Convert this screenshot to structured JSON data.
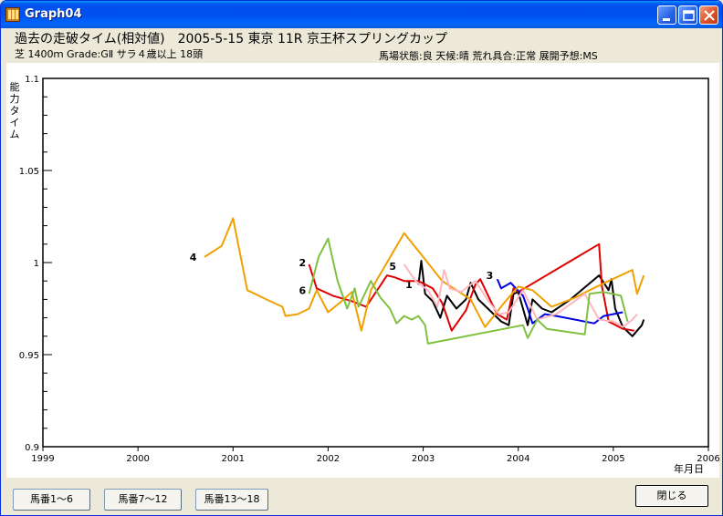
{
  "window": {
    "title": "Graph04"
  },
  "header": {
    "line1": "過去の走破タイム(相対値)　2005-5-15  東京  11R  京王杯スプリングカップ",
    "line2": "芝 1400ｍ  Grade:GⅡ  サラ４歳以上  18頭",
    "conditions": "馬場状態:良    天候:晴    荒れ具合:正常    展開予想:MS"
  },
  "buttons": {
    "horses_1_6": "馬番1～6",
    "horses_7_12": "馬番7～12",
    "horses_13_18": "馬番13～18",
    "close": "閉じる"
  },
  "chart_data": {
    "type": "line",
    "ylabel": "能力タイム",
    "xlabel": "年月日",
    "ylim": [
      0.9,
      1.1
    ],
    "xlim": [
      1999,
      2006
    ],
    "yticks": [
      "1.1",
      "1.05",
      "1",
      "0.95",
      "0.9"
    ],
    "xticks": [
      "1999",
      "2000",
      "2001",
      "2002",
      "2003",
      "2004",
      "2005",
      "2006"
    ],
    "grid": false,
    "series": [
      {
        "name": "1",
        "color": "#000000",
        "label_at": [
          2002.85,
          0.988
        ],
        "points": [
          [
            2002.95,
            0.988
          ],
          [
            2002.98,
            1.001
          ],
          [
            2003.02,
            0.983
          ],
          [
            2003.1,
            0.979
          ],
          [
            2003.18,
            0.97
          ],
          [
            2003.25,
            0.982
          ],
          [
            2003.35,
            0.975
          ],
          [
            2003.45,
            0.98
          ],
          [
            2003.5,
            0.989
          ],
          [
            2003.58,
            0.98
          ],
          [
            2003.72,
            0.973
          ],
          [
            2003.82,
            0.968
          ],
          [
            2003.9,
            0.966
          ],
          [
            2003.95,
            0.983
          ],
          [
            2004.0,
            0.984
          ],
          [
            2004.05,
            0.975
          ],
          [
            2004.1,
            0.966
          ],
          [
            2004.15,
            0.98
          ],
          [
            2004.25,
            0.975
          ],
          [
            2004.35,
            0.973
          ],
          [
            2004.55,
            0.98
          ],
          [
            2004.85,
            0.993
          ],
          [
            2004.95,
            0.985
          ],
          [
            2004.98,
            0.991
          ],
          [
            2005.02,
            0.975
          ],
          [
            2005.1,
            0.965
          ],
          [
            2005.2,
            0.96
          ],
          [
            2005.3,
            0.966
          ],
          [
            2005.32,
            0.969
          ]
        ]
      },
      {
        "name": "2",
        "color": "#E00000",
        "label_at": [
          2001.73,
          1.0
        ],
        "points": [
          [
            2001.8,
            0.999
          ],
          [
            2001.88,
            0.986
          ],
          [
            2002.05,
            0.982
          ],
          [
            2002.25,
            0.979
          ],
          [
            2002.4,
            0.976
          ],
          [
            2002.62,
            0.993
          ],
          [
            2002.7,
            0.992
          ],
          [
            2002.8,
            0.99
          ],
          [
            2002.95,
            0.99
          ],
          [
            2003.1,
            0.986
          ],
          [
            2003.2,
            0.978
          ],
          [
            2003.3,
            0.963
          ],
          [
            2003.45,
            0.974
          ],
          [
            2003.55,
            0.988
          ],
          [
            2003.6,
            0.991
          ],
          [
            2003.72,
            0.978
          ],
          [
            2003.78,
            0.972
          ],
          [
            2003.88,
            0.969
          ],
          [
            2003.95,
            0.986
          ],
          [
            2004.0,
            0.984
          ],
          [
            2004.85,
            1.01
          ],
          [
            2004.88,
            0.987
          ],
          [
            2004.95,
            0.968
          ],
          [
            2005.1,
            0.964
          ],
          [
            2005.22,
            0.963
          ]
        ]
      },
      {
        "name": "3",
        "color": "#0000E0",
        "label_at": [
          2003.7,
          0.993
        ],
        "points": [
          [
            2003.78,
            0.991
          ],
          [
            2003.82,
            0.986
          ],
          [
            2003.92,
            0.989
          ],
          [
            2004.05,
            0.982
          ],
          [
            2004.1,
            0.975
          ],
          [
            2004.15,
            0.967
          ],
          [
            2004.28,
            0.972
          ],
          [
            2004.4,
            0.971
          ],
          [
            2004.8,
            0.967
          ],
          [
            2004.9,
            0.971
          ],
          [
            2005.1,
            0.973
          ]
        ]
      },
      {
        "name": "4",
        "color": "#F0A000",
        "label_at": [
          2000.58,
          1.003
        ],
        "points": [
          [
            2000.7,
            1.003
          ],
          [
            2000.88,
            1.009
          ],
          [
            2001.0,
            1.024
          ],
          [
            2001.15,
            0.985
          ],
          [
            2001.35,
            0.98
          ],
          [
            2001.52,
            0.976
          ],
          [
            2001.55,
            0.971
          ],
          [
            2001.68,
            0.972
          ],
          [
            2001.8,
            0.975
          ],
          [
            2001.88,
            0.985
          ],
          [
            2002.0,
            0.973
          ],
          [
            2002.12,
            0.978
          ],
          [
            2002.25,
            0.984
          ],
          [
            2002.35,
            0.963
          ],
          [
            2002.45,
            0.985
          ],
          [
            2002.8,
            1.016
          ],
          [
            2003.0,
            1.003
          ],
          [
            2003.2,
            0.99
          ],
          [
            2003.5,
            0.98
          ],
          [
            2003.65,
            0.965
          ],
          [
            2003.85,
            0.978
          ],
          [
            2004.0,
            0.987
          ],
          [
            2004.15,
            0.985
          ],
          [
            2004.35,
            0.976
          ],
          [
            2004.6,
            0.981
          ],
          [
            2004.75,
            0.985
          ],
          [
            2004.95,
            0.99
          ],
          [
            2005.2,
            0.996
          ],
          [
            2005.25,
            0.983
          ],
          [
            2005.32,
            0.993
          ]
        ]
      },
      {
        "name": "5",
        "color": "#FFB6C1",
        "label_at": [
          2002.68,
          0.998
        ],
        "points": [
          [
            2002.8,
            0.999
          ],
          [
            2002.92,
            0.99
          ],
          [
            2003.05,
            0.985
          ],
          [
            2003.15,
            0.976
          ],
          [
            2003.22,
            0.996
          ],
          [
            2003.28,
            0.986
          ],
          [
            2003.4,
            0.984
          ],
          [
            2003.55,
            0.99
          ],
          [
            2003.7,
            0.978
          ],
          [
            2003.8,
            0.972
          ],
          [
            2003.9,
            0.973
          ],
          [
            2004.05,
            0.985
          ],
          [
            2004.2,
            0.969
          ],
          [
            2004.4,
            0.972
          ],
          [
            2004.7,
            0.983
          ],
          [
            2004.85,
            0.969
          ],
          [
            2005.0,
            0.968
          ],
          [
            2005.1,
            0.965
          ],
          [
            2005.2,
            0.969
          ],
          [
            2005.25,
            0.972
          ]
        ]
      },
      {
        "name": "6",
        "color": "#80C040",
        "label_at": [
          2001.73,
          0.985
        ],
        "points": [
          [
            2001.8,
            0.983
          ],
          [
            2001.9,
            1.003
          ],
          [
            2002.0,
            1.013
          ],
          [
            2002.1,
            0.99
          ],
          [
            2002.2,
            0.975
          ],
          [
            2002.28,
            0.986
          ],
          [
            2002.32,
            0.976
          ],
          [
            2002.45,
            0.99
          ],
          [
            2002.55,
            0.981
          ],
          [
            2002.65,
            0.975
          ],
          [
            2002.72,
            0.967
          ],
          [
            2002.8,
            0.971
          ],
          [
            2002.88,
            0.969
          ],
          [
            2002.95,
            0.971
          ],
          [
            2003.02,
            0.966
          ],
          [
            2003.05,
            0.956
          ],
          [
            2004.05,
            0.966
          ],
          [
            2004.1,
            0.959
          ],
          [
            2004.2,
            0.969
          ],
          [
            2004.3,
            0.964
          ],
          [
            2004.7,
            0.961
          ],
          [
            2004.75,
            0.983
          ],
          [
            2004.9,
            0.984
          ],
          [
            2005.08,
            0.982
          ],
          [
            2005.15,
            0.968
          ]
        ]
      }
    ]
  }
}
